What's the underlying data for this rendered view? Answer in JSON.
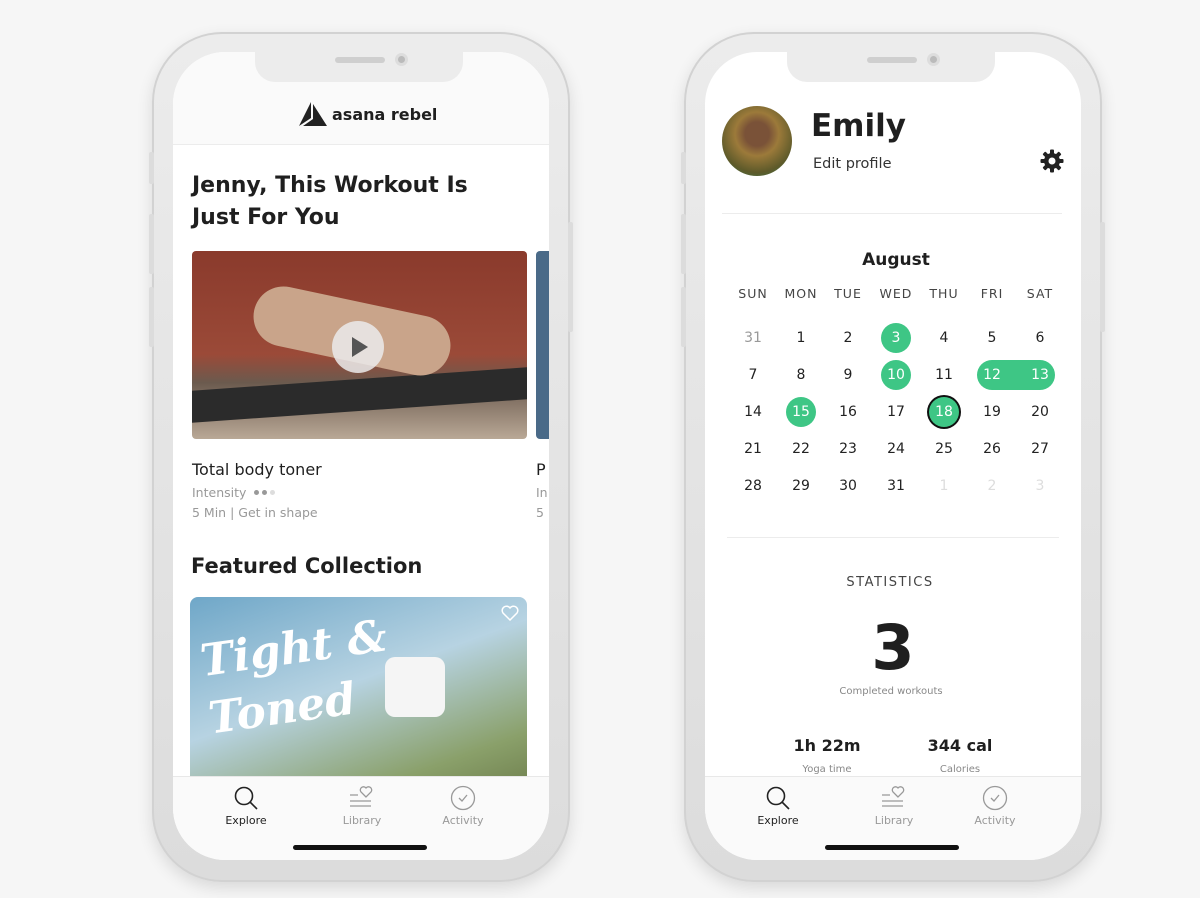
{
  "colors": {
    "accent": "#3ec685",
    "text": "#1f1f1f",
    "muted": "#999999"
  },
  "explore": {
    "brand": "asana rebel",
    "heading": "Jenny, This Workout Is Just For You",
    "workout": {
      "title": "Total body toner",
      "intensity_label": "Intensity",
      "intensity_level": 2,
      "intensity_max": 3,
      "meta": "5 Min | Get in shape",
      "icon": "play-icon"
    },
    "next_card": {
      "title_partial": "P",
      "intensity_partial": "In",
      "meta_partial": "5"
    },
    "featured_heading": "Featured Collection",
    "featured_card": {
      "title_art": "Tight & Toned",
      "icon": "heart-icon"
    }
  },
  "profile": {
    "name": "Emily",
    "edit_label": "Edit profile",
    "icon": "gear-icon",
    "calendar": {
      "month": "August",
      "weekdays": [
        "SUN",
        "MON",
        "TUE",
        "WED",
        "THU",
        "FRI",
        "SAT"
      ],
      "weeks": [
        [
          "31",
          "1",
          "2",
          "3",
          "4",
          "5",
          "6"
        ],
        [
          "7",
          "8",
          "9",
          "10",
          "11",
          "12",
          "13"
        ],
        [
          "14",
          "15",
          "16",
          "17",
          "18",
          "19",
          "20"
        ],
        [
          "21",
          "22",
          "23",
          "24",
          "25",
          "26",
          "27"
        ],
        [
          "28",
          "29",
          "30",
          "31",
          "1",
          "2",
          "3"
        ]
      ],
      "completed_days": [
        3,
        10,
        12,
        13,
        15,
        18
      ],
      "today": 18
    },
    "statistics": {
      "heading": "STATISTICS",
      "completed": "3",
      "completed_label": "Completed workouts",
      "yoga_time": "1h 22m",
      "yoga_label": "Yoga time",
      "calories": "344 cal",
      "calories_label": "Calories"
    }
  },
  "tabbar": {
    "tabs": [
      {
        "label": "Explore",
        "icon": "search-icon",
        "active": true
      },
      {
        "label": "Library",
        "icon": "library-heart-icon",
        "active": false
      },
      {
        "label": "Activity",
        "icon": "check-circle-icon",
        "active": false
      }
    ]
  }
}
